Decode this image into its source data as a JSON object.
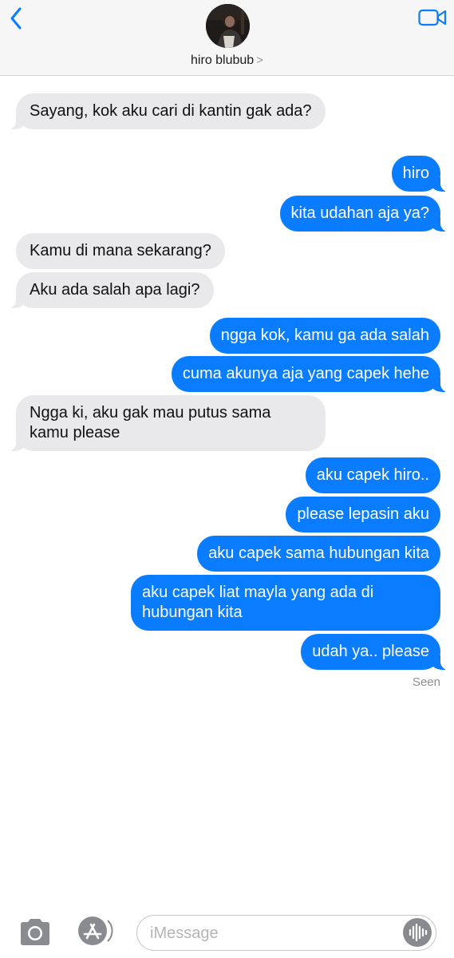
{
  "header": {
    "contact_name": "hiro blubub",
    "chevron": ">"
  },
  "messages": [
    {
      "side": "recv",
      "text": "Sayang, kok aku cari di kantin gak ada?"
    },
    {
      "side": "sent",
      "text": "hiro"
    },
    {
      "side": "sent",
      "text": "kita udahan aja ya?"
    },
    {
      "side": "recv",
      "text": "Kamu di mana sekarang?"
    },
    {
      "side": "recv",
      "text": "Aku ada salah apa lagi?"
    },
    {
      "side": "sent",
      "text": "ngga kok, kamu ga ada salah"
    },
    {
      "side": "sent",
      "text": "cuma akunya aja yang capek hehe"
    },
    {
      "side": "recv",
      "text": "Ngga ki, aku gak mau putus sama kamu please"
    },
    {
      "side": "sent",
      "text": "aku capek hiro.."
    },
    {
      "side": "sent",
      "text": "please lepasin aku"
    },
    {
      "side": "sent",
      "text": "aku capek sama hubungan kita"
    },
    {
      "side": "sent",
      "text": "aku capek liat mayla yang ada di hubungan kita"
    },
    {
      "side": "sent",
      "text": "udah ya.. please"
    }
  ],
  "status": {
    "seen": "Seen"
  },
  "composer": {
    "placeholder": "iMessage"
  },
  "colors": {
    "sent_bubble": "#0a7cff",
    "received_bubble": "#e9e9eb",
    "accent": "#0a7cff"
  },
  "icons": {
    "back": "chevron-left-icon",
    "video": "video-camera-icon",
    "camera": "camera-icon",
    "apps": "app-store-icon",
    "audio": "audio-waveform-icon"
  }
}
